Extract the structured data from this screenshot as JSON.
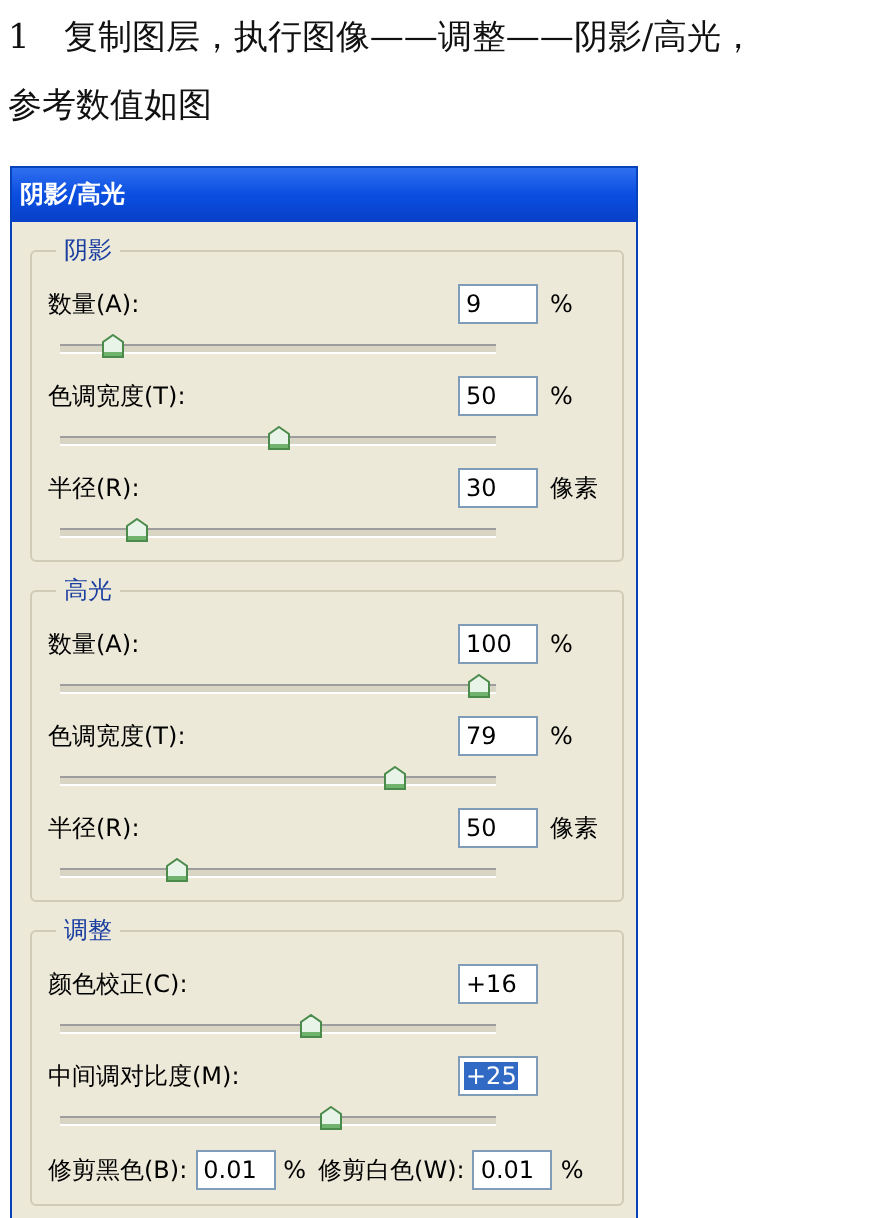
{
  "instruction": {
    "lines": [
      "1　复制图层，执行图像——调整——阴影/高光，",
      "参考数值如图"
    ]
  },
  "dialog": {
    "title": "阴影/高光",
    "groups": [
      {
        "title": "阴影",
        "rows": [
          {
            "kind": "slider",
            "label": "数量(A):",
            "value": "9",
            "unit": "%",
            "selected": false,
            "level": 0.09
          },
          {
            "kind": "slider",
            "label": "色调宽度(T):",
            "value": "50",
            "unit": "%",
            "selected": false,
            "level": 0.5
          },
          {
            "kind": "slider",
            "label": "半径(R):",
            "value": "30",
            "unit": "像素",
            "selected": false,
            "level": 0.15
          }
        ]
      },
      {
        "title": "高光",
        "rows": [
          {
            "kind": "slider",
            "label": "数量(A):",
            "value": "100",
            "unit": "%",
            "selected": false,
            "level": 1.0
          },
          {
            "kind": "slider",
            "label": "色调宽度(T):",
            "value": "79",
            "unit": "%",
            "selected": false,
            "level": 0.79
          },
          {
            "kind": "slider",
            "label": "半径(R):",
            "value": "50",
            "unit": "像素",
            "selected": false,
            "level": 0.25
          }
        ]
      },
      {
        "title": "调整",
        "rows": [
          {
            "kind": "slider",
            "label": "颜色校正(C):",
            "value": "+16",
            "selected": false,
            "level": 0.58
          },
          {
            "kind": "slider",
            "label": "中间调对比度(M):",
            "value": "+25",
            "selected": true,
            "level": 0.63
          },
          {
            "kind": "pair",
            "fields": [
              {
                "label": "修剪黑色(B):",
                "value": "0.01",
                "unit": "%"
              },
              {
                "label": "修剪白色(W):",
                "value": "0.01",
                "unit": "%"
              }
            ]
          }
        ]
      }
    ]
  }
}
